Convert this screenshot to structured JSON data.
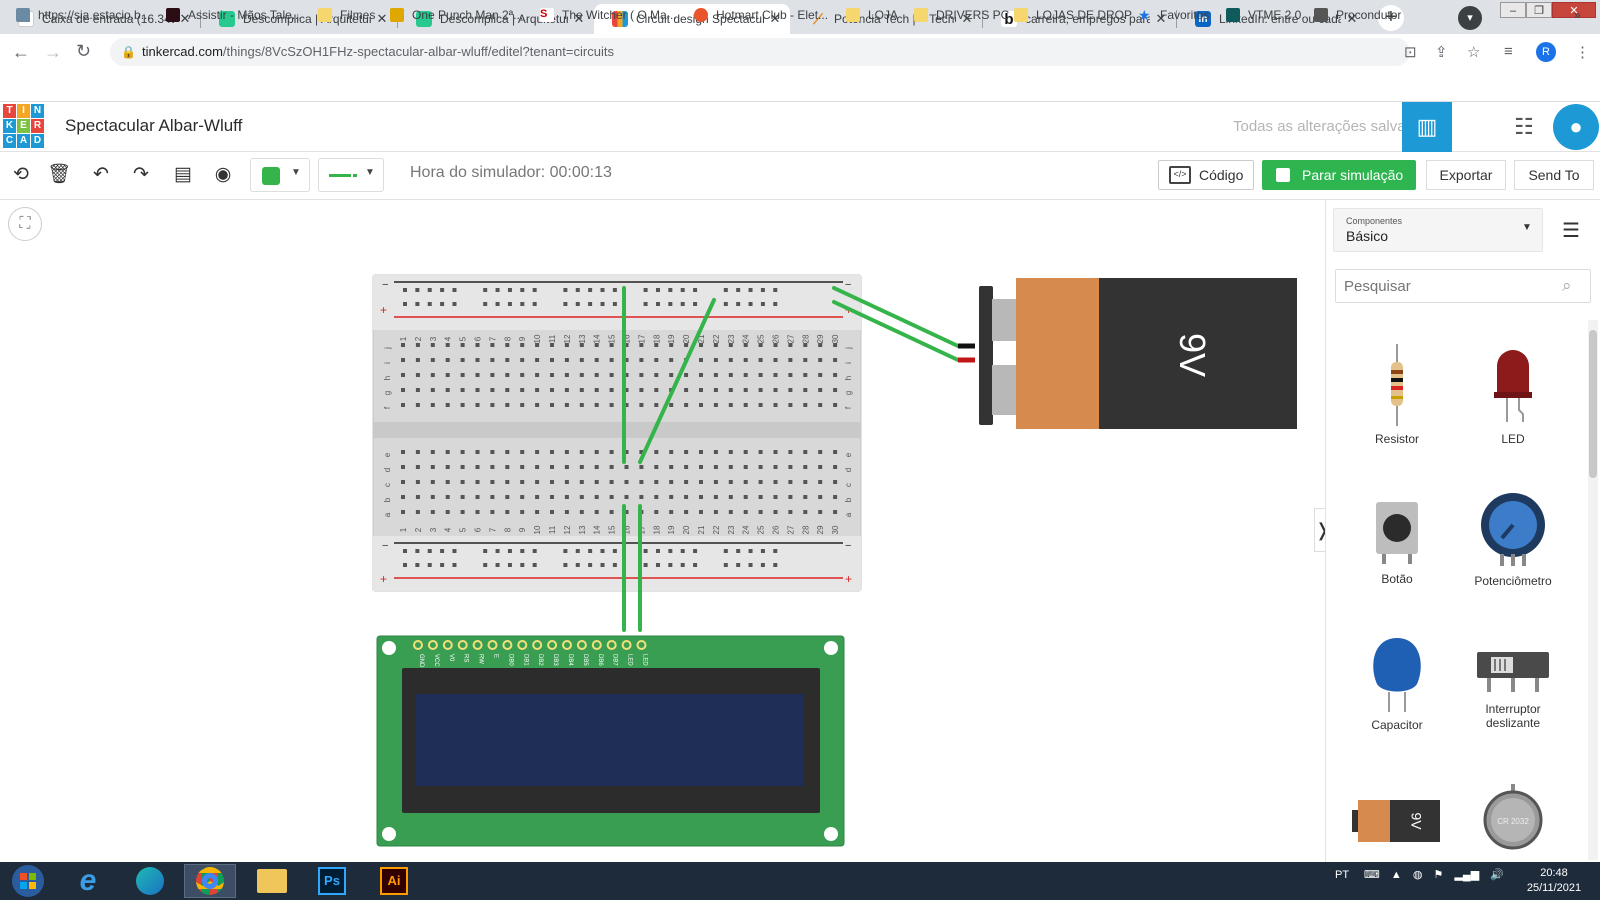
{
  "browser": {
    "tabs": [
      {
        "title": "Caixa de entrada (16.345)",
        "icon": "gmail-icon"
      },
      {
        "title": "Descomplica | Arquitetur",
        "icon": "descomplica-icon"
      },
      {
        "title": "Descomplica | Arquitetur",
        "icon": "descomplica-icon"
      },
      {
        "title": "Circuit design Spectacul",
        "icon": "tinkercad-icon",
        "active": true
      },
      {
        "title": "Potencia Tech | < Tecnol",
        "icon": "potencia-icon"
      },
      {
        "title": "carreira, empregos para",
        "icon": "b-icon"
      },
      {
        "title": "LinkedIn: entre ou cadas",
        "icon": "linkedin-icon"
      }
    ],
    "url_host": "tinkercad.com",
    "url_path": "/things/8VcSzOH1FHz-spectacular-albar-wluff/editel?tenant=circuits",
    "profile_initial": "R",
    "bookmarks": [
      "https://sia.estacio.b...",
      "Assistir - Mãos Tale...",
      "Filmes",
      "One Punch Man 2ª...",
      "The Witcher ( O Ma...",
      "Hotmart Club - Elet...",
      "LOJA",
      "DRIVERS PC",
      "LOJAS DE DROP",
      "Favoritos",
      "VTME 2.0",
      "Procondutor"
    ]
  },
  "app": {
    "logo_letters": [
      "T",
      "I",
      "N",
      "K",
      "E",
      "R",
      "C",
      "A",
      "D"
    ],
    "design_title": "Spectacular Albar-Wluff",
    "saved_status": "Todas as alterações salvas"
  },
  "toolbar": {
    "sim_time": "Hora do simulador: 00:00:13",
    "code_label": "Código",
    "stop_label": "Parar simulação",
    "export_label": "Exportar",
    "send_label": "Send To",
    "wire_color": "#34b44a"
  },
  "circuit": {
    "breadboard_columns": [
      "1",
      "2",
      "3",
      "4",
      "5",
      "6",
      "7",
      "8",
      "9",
      "10",
      "11",
      "12",
      "13",
      "14",
      "15",
      "16",
      "17",
      "18",
      "19",
      "20",
      "21",
      "22",
      "23",
      "24",
      "25",
      "26",
      "27",
      "28",
      "29",
      "30"
    ],
    "rows_top": [
      "j",
      "i",
      "h",
      "g",
      "f"
    ],
    "rows_bottom": [
      "e",
      "d",
      "c",
      "b",
      "a"
    ],
    "rail_minus": "−",
    "rail_plus": "+",
    "battery_label": "9V",
    "lcd_pins": [
      "GND",
      "VCC",
      "V0",
      "RS",
      "RW",
      "E",
      "DB0",
      "DB1",
      "DB2",
      "DB3",
      "DB4",
      "DB5",
      "DB6",
      "DB7",
      "LED",
      "LED"
    ]
  },
  "panel": {
    "components_label": "Componentes",
    "components_value": "Básico",
    "search_placeholder": "Pesquisar",
    "items": [
      {
        "label": "Resistor"
      },
      {
        "label": "LED"
      },
      {
        "label": "Botão"
      },
      {
        "label": "Potenciômetro"
      },
      {
        "label": "Capacitor"
      },
      {
        "label": "Interruptor deslizante"
      },
      {
        "label": "9V"
      },
      {
        "label": "CR 2032"
      }
    ]
  },
  "taskbar": {
    "apps": [
      "Start",
      "Internet Explorer",
      "Edge",
      "Chrome",
      "Explorer",
      "Ps",
      "Ai"
    ],
    "lang": "PT",
    "time": "20:48",
    "date": "25/11/2021"
  }
}
